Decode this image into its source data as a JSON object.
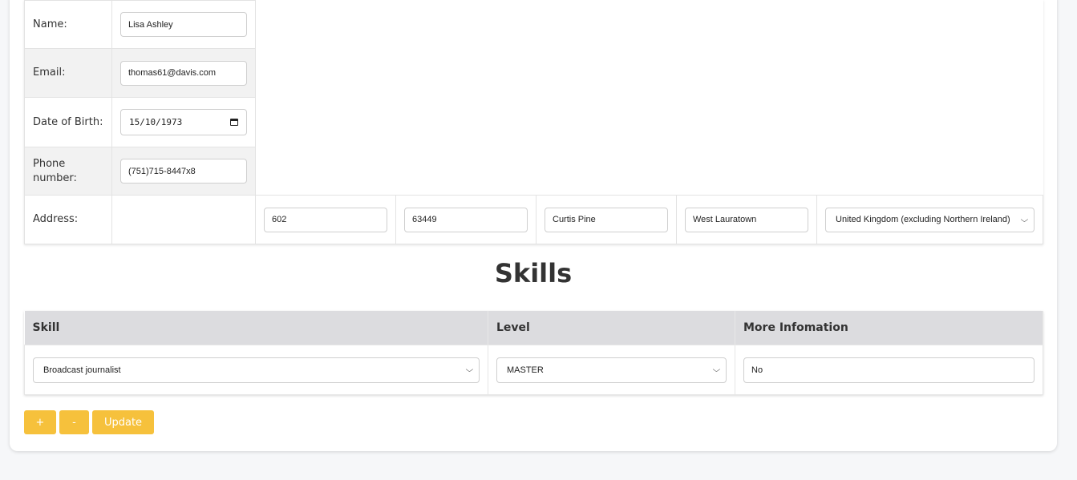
{
  "personal": {
    "name_label": "Name:",
    "name_value": "Lisa Ashley",
    "email_label": "Email:",
    "email_value": "thomas61@davis.com",
    "dob_label": "Date of Birth:",
    "dob_value": "15/10/1973",
    "phone_label": "Phone number:",
    "phone_value": "(751)715-8447x8",
    "address_label": "Address:",
    "address": {
      "number": "602",
      "postcode": "63449",
      "street": "Curtis Pine",
      "city": "West Lauratown",
      "country": "United Kingdom (excluding Northern Ireland)"
    }
  },
  "skills": {
    "title": "Skills",
    "headers": {
      "skill": "Skill",
      "level": "Level",
      "more": "More Infomation"
    },
    "rows": [
      {
        "skill": "Broadcast journalist",
        "level": "MASTER",
        "more": "No"
      }
    ]
  },
  "actions": {
    "add_label": "+",
    "remove_label": "-",
    "update_label": "Update"
  },
  "colors": {
    "accent": "#f6c13c",
    "header_bg": "#dcdcdf",
    "shade_bg": "#f2f2f2"
  }
}
